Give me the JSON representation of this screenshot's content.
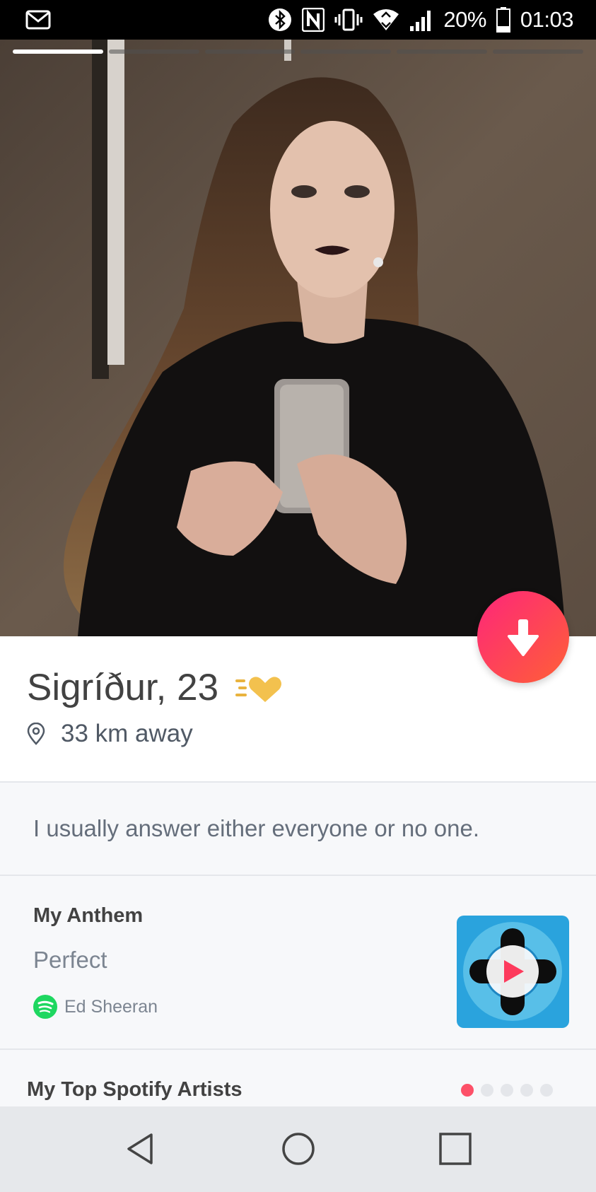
{
  "status_bar": {
    "battery_text": "20%",
    "time": "01:03",
    "icons": [
      "mail-icon",
      "bluetooth-icon",
      "nfc-icon",
      "vibrate-icon",
      "wifi-icon",
      "signal-icon",
      "battery-icon"
    ]
  },
  "photo": {
    "total_photos": 6,
    "current_photo": 1
  },
  "profile": {
    "name_age": "Sigríður, 23",
    "distance": "33 km away",
    "bio": "I usually answer either everyone or no one."
  },
  "anthem": {
    "label": "My Anthem",
    "song": "Perfect",
    "artist": "Ed Sheeran"
  },
  "spotify": {
    "label": "My Top Spotify Artists",
    "page_count": 5,
    "active_page": 1
  },
  "colors": {
    "accent_start": "#fd267a",
    "accent_end": "#ff6036",
    "spotify_green": "#1ed760",
    "album_blue": "#2aa3dd",
    "gold": "#e9b33e"
  }
}
